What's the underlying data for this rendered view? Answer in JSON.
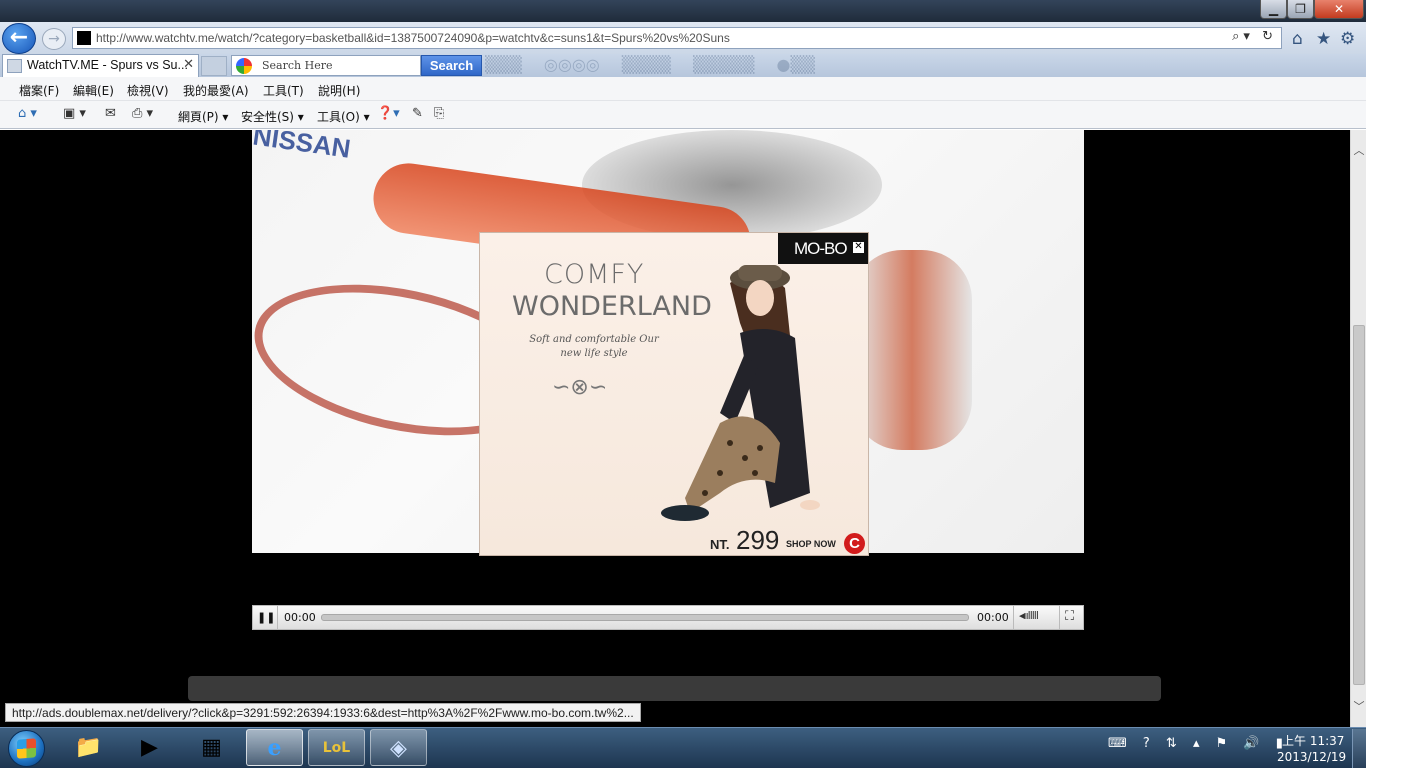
{
  "window": {
    "min_label": "▁",
    "max_label": "❐",
    "close_label": "✕"
  },
  "address": {
    "url": "http://www.watchtv.me/watch/?category=basketball&id=1387500724090&p=watchtv&c=suns1&t=Spurs%20vs%20Suns",
    "icons": "⌕▾ ↻"
  },
  "tab": {
    "title": "WatchTV.ME - Spurs vs Su...",
    "close": "✕"
  },
  "search": {
    "placeholder": "Search Here",
    "button": "Search"
  },
  "menu": {
    "items": [
      "檔案(F)",
      "編輯(E)",
      "檢視(V)",
      "我的最愛(A)",
      "工具(T)",
      "說明(H)"
    ]
  },
  "commandbar": {
    "page": "網頁(P)",
    "safety": "安全性(S)",
    "tools": "工具(O)"
  },
  "ad": {
    "brand": "MO-BO",
    "headline_line1": "COMFY",
    "headline_line2": "WONDERLAND",
    "tagline": "Soft and comfortable Our new life style",
    "price_prefix": "NT.",
    "price": "299",
    "cta": "SHOP NOW",
    "logo_letter": "C"
  },
  "player": {
    "current_time": "00:00",
    "total_time": "00:00",
    "progress": 0,
    "pause_icon": "❚❚",
    "volume_icon": "◂ıılllll",
    "fullscreen_icon": "⛶"
  },
  "status": {
    "link_url": "http://ads.doublemax.net/delivery/?click&p=3291:592:26394:1933:6&dest=http%3A%2F%2Fwww.mo-bo.com.tw%2..."
  },
  "taskbar": {
    "clock_time": "上午 11:37",
    "clock_date": "2013/12/19",
    "tray_icons": "⌨ ? ⇅ ▴ ⚑ 🔊 ▮"
  },
  "colors": {
    "search_button": "#2f67c8",
    "ad_logo_red": "#d21b1b",
    "content_bg": "#000000"
  }
}
